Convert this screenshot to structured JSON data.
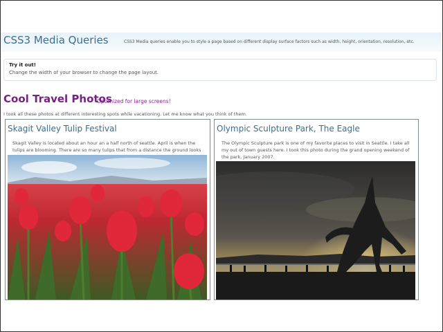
{
  "site": {
    "title": "CSS3 Media Queries",
    "description": "CSS3 Media queries enable you to style a page based on different display surface factors such as width, height, orientation, resolution, etc."
  },
  "try_it": {
    "title": "Try it out!",
    "text": "Change the width of your browser to change the page layout."
  },
  "page": {
    "heading": "Cool Travel Photos",
    "subheading": "Optimized for large screens!",
    "intro": "I took all these photos at different interesting spots while vacationing. Let me know what you think of them."
  },
  "cards": [
    {
      "title": "Skagit Valley Tulip Festival",
      "text": "Skagit Valley is located about an hour an a half north of seattle. April is when the tulips are blooming. There are so many tulips that from a distance the ground looks like it's painted.",
      "photo_icon": "tulip-field-photo"
    },
    {
      "title": "Olympic Sculpture Park, The Eagle",
      "text": "The Olympic Sculpture park is one of my favorite places to visit in Seattle. I take all my out of town guests here. I took this photo during the grand opening weekend of the park, January 2007.",
      "photo_icon": "eagle-sculpture-photo"
    }
  ],
  "colors": {
    "title_blue": "#3f6e8c",
    "heading_purple": "#7a1f86",
    "card_title_blue": "#3b6e8e",
    "header_gradient_top": "#e6f2f9"
  }
}
